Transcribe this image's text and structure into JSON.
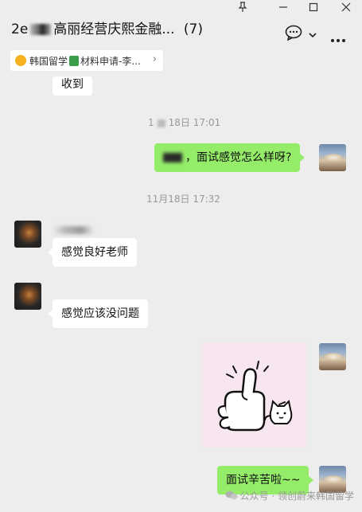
{
  "window": {
    "pin_icon": "pin-icon",
    "minimize_icon": "minimize-icon",
    "maximize_icon": "maximize-icon",
    "close_icon": "close-icon"
  },
  "header": {
    "title_prefix": "2e",
    "title_main": "高丽经营庆熙金融...",
    "member_count": "(7)"
  },
  "pinned": {
    "label": "韩国留学",
    "note_text": "材料申请-李..."
  },
  "messages": {
    "m0_text": "收到",
    "time1": "18日 17:01",
    "time1_prefix": "1",
    "m1_text": "，面试感觉怎么样呀?",
    "time2": "11月18日 17:32",
    "m2_text": "感觉良好老师",
    "m3_text": "感觉应该没问题",
    "m4_text": "面试辛苦啦~~"
  },
  "watermark": {
    "text": "公众号 · 领创蔚来韩国留学"
  }
}
